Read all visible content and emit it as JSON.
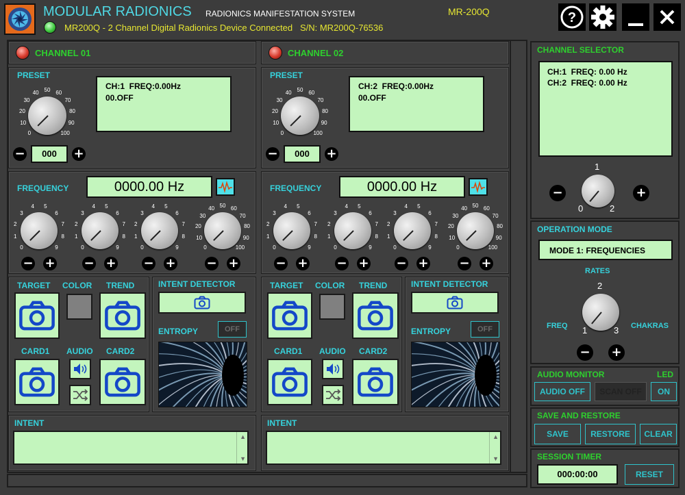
{
  "app": {
    "title": "MODULAR RADIONICS",
    "subtitle": "RADIONICS MANIFESTATION SYSTEM",
    "model": "MR-200Q",
    "status": "MR200Q - 2 Channel Digital Radionics Device Connected   S/N: MR200Q-76536"
  },
  "channels": [
    {
      "name": "CHANNEL 01",
      "preset_label": "PRESET",
      "display_line1": "CH:1  FREQ:0.00Hz",
      "display_line2": "00.OFF",
      "preset_value": "000",
      "frequency_label": "FREQUENCY",
      "frequency_value": "0000.00 Hz",
      "target_label": "TARGET",
      "color_label": "COLOR",
      "trend_label": "TREND",
      "card1_label": "CARD1",
      "audio_label": "AUDIO",
      "card2_label": "CARD2",
      "intent_detector_label": "INTENT DETECTOR",
      "entropy_label": "ENTROPY",
      "entropy_state": "OFF",
      "intent_label": "INTENT"
    },
    {
      "name": "CHANNEL 02",
      "preset_label": "PRESET",
      "display_line1": "CH:2  FREQ:0.00Hz",
      "display_line2": "00.OFF",
      "preset_value": "000",
      "frequency_label": "FREQUENCY",
      "frequency_value": "0000.00 Hz",
      "target_label": "TARGET",
      "color_label": "COLOR",
      "trend_label": "TREND",
      "card1_label": "CARD1",
      "audio_label": "AUDIO",
      "card2_label": "CARD2",
      "intent_detector_label": "INTENT DETECTOR",
      "entropy_label": "ENTROPY",
      "entropy_state": "OFF",
      "intent_label": "INTENT"
    }
  ],
  "dial_ticks": {
    "preset": [
      "0",
      "10",
      "20",
      "30",
      "40",
      "50",
      "60",
      "70",
      "80",
      "90",
      "100"
    ],
    "digit": [
      "0",
      "1",
      "2",
      "3",
      "4",
      "5",
      "6",
      "7",
      "8",
      "9"
    ]
  },
  "selector": {
    "title": "CHANNEL SELECTOR",
    "line1": "CH:1  FREQ: 0.00 Hz",
    "line2": "CH:2  FREQ: 0.00 Hz",
    "tick0": "0",
    "tick1": "1",
    "tick2": "2"
  },
  "operation": {
    "title": "OPERATION  MODE",
    "mode": "MODE 1: FREQUENCIES",
    "rates": "RATES",
    "freq": "FREQ",
    "chakras": "CHAKRAS",
    "tick1": "1",
    "tick2": "2",
    "tick3": "3"
  },
  "audio_monitor": {
    "title": "AUDIO MONITOR",
    "led": "LED",
    "audio_off": "AUDIO OFF",
    "scan_off": "SCAN OFF",
    "on": "ON"
  },
  "save_restore": {
    "title": "SAVE AND RESTORE",
    "save": "SAVE",
    "restore": "RESTORE",
    "clear": "CLEAR"
  },
  "timer": {
    "title": "SESSION TIMER",
    "value": "000:00:00",
    "reset": "RESET"
  },
  "colors": {
    "accent": "#36d2dc",
    "lcd": "#c3f5bd",
    "title_green": "#2ed02e",
    "status_yellow": "#e6e632",
    "logo_orange": "#e46a1c"
  }
}
